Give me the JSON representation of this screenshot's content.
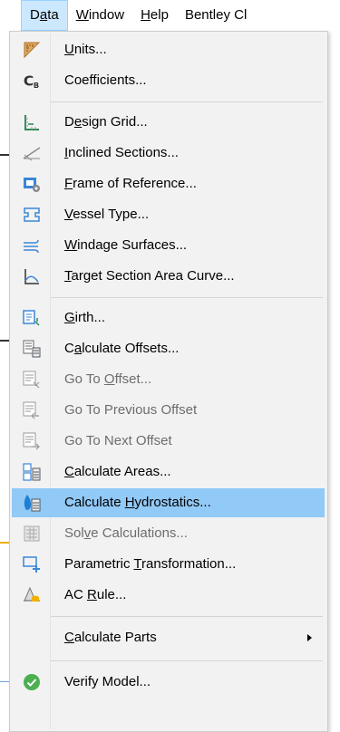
{
  "menubar": {
    "items": [
      {
        "pre": "D",
        "u": "a",
        "post": "ta"
      },
      {
        "pre": "",
        "u": "W",
        "post": "indow"
      },
      {
        "pre": "",
        "u": "H",
        "post": "elp"
      },
      {
        "pre": "Bentley Cl",
        "u": "",
        "post": ""
      }
    ]
  },
  "menu": {
    "items": [
      {
        "pre": "",
        "u": "U",
        "post": "nits...",
        "icon": "units-icon"
      },
      {
        "pre": "Coefficients...",
        "u": "",
        "post": "",
        "icon": "coefficients-icon"
      },
      {
        "pre": "D",
        "u": "e",
        "post": "sign Grid...",
        "icon": "design-grid-icon"
      },
      {
        "pre": "",
        "u": "I",
        "post": "nclined Sections...",
        "icon": "inclined-sections-icon"
      },
      {
        "pre": "",
        "u": "F",
        "post": "rame of Reference...",
        "icon": "frame-of-reference-icon"
      },
      {
        "pre": "",
        "u": "V",
        "post": "essel Type...",
        "icon": "vessel-type-icon"
      },
      {
        "pre": "",
        "u": "W",
        "post": "indage Surfaces...",
        "icon": "windage-surfaces-icon"
      },
      {
        "pre": "",
        "u": "T",
        "post": "arget Section Area Curve...",
        "icon": "target-section-area-curve-icon"
      },
      {
        "pre": "",
        "u": "G",
        "post": "irth...",
        "icon": "girth-icon"
      },
      {
        "pre": "C",
        "u": "a",
        "post": "lculate Offsets...",
        "icon": "calculate-offsets-icon"
      },
      {
        "pre": "Go To ",
        "u": "O",
        "post": "ffset...",
        "icon": "go-to-offset-icon",
        "disabled": true
      },
      {
        "pre": "Go To Previous Offset",
        "u": "",
        "post": "",
        "icon": "go-to-previous-offset-icon",
        "disabled": true
      },
      {
        "pre": "Go To Next Offset",
        "u": "",
        "post": "",
        "icon": "go-to-next-offset-icon",
        "disabled": true
      },
      {
        "pre": "",
        "u": "C",
        "post": "alculate Areas...",
        "icon": "calculate-areas-icon"
      },
      {
        "pre": "Calculate ",
        "u": "H",
        "post": "ydrostatics...",
        "icon": "calculate-hydrostatics-icon"
      },
      {
        "pre": "Sol",
        "u": "v",
        "post": "e Calculations...",
        "icon": "solve-calculations-icon",
        "disabled": true
      },
      {
        "pre": "Parametric ",
        "u": "T",
        "post": "ransformation...",
        "icon": "parametric-transformation-icon"
      },
      {
        "pre": "AC ",
        "u": "R",
        "post": "ule...",
        "icon": "ac-rule-icon"
      },
      {
        "pre": "",
        "u": "C",
        "post": "alculate Parts",
        "icon": ""
      },
      {
        "pre": "Verify Model...",
        "u": "",
        "post": "",
        "icon": "verify-model-icon"
      }
    ]
  },
  "colors": {
    "highlight": "#91c9f7",
    "menubar_active": "#cce8ff",
    "menu_bg": "#f2f2f2"
  }
}
